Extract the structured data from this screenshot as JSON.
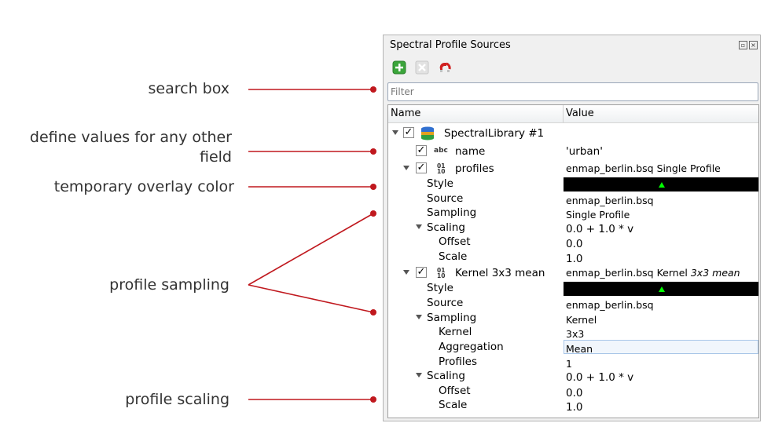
{
  "annotations": {
    "search_box": "search box",
    "define_values_line1": "define values for any other",
    "define_values_line2": "field",
    "overlay_color": "temporary overlay color",
    "profile_sampling": "profile sampling",
    "profile_scaling": "profile scaling",
    "line_color": "#c0181e"
  },
  "panel": {
    "title": "Spectral Profile Sources",
    "toolbar": {
      "add_icon": "add-icon",
      "remove_icon": "remove-icon",
      "magnet_icon": "magnet-icon"
    },
    "filter_placeholder": "Filter",
    "columns": {
      "name": "Name",
      "value": "Value"
    },
    "tree": {
      "library": {
        "label": "SpectralLibrary #1"
      },
      "name_field": {
        "label": "name",
        "value": "'urban'",
        "type_icon": "abc"
      },
      "profiles": {
        "label": "profiles",
        "value": "enmap_berlin.bsq Single Profile",
        "type_icon": "binary",
        "style_label": "Style",
        "style_color": "#000000",
        "source_label": "Source",
        "source_value": "enmap_berlin.bsq",
        "sampling_label": "Sampling",
        "sampling_value": "Single Profile",
        "scaling_label": "Scaling",
        "scaling_value": "0.0 + 1.0 * v",
        "offset_label": "Offset",
        "offset_value": "0.0",
        "scale_label": "Scale",
        "scale_value": "1.0"
      },
      "kernel": {
        "label": "Kernel 3x3 mean",
        "value_prefix": "enmap_berlin.bsq Kernel",
        "value_suffix": "3x3 mean",
        "type_icon": "binary",
        "style_label": "Style",
        "style_color": "#000000",
        "source_label": "Source",
        "source_value": "enmap_berlin.bsq",
        "sampling_label": "Sampling",
        "sampling_value": "Kernel",
        "kernel_label": "Kernel",
        "kernel_value": "3x3",
        "aggregation_label": "Aggregation",
        "aggregation_value": "Mean",
        "profiles_label": "Profiles",
        "profiles_value": "1",
        "scaling_label": "Scaling",
        "scaling_value": "0.0 + 1.0 * v",
        "offset_label": "Offset",
        "offset_value": "0.0",
        "scale_label": "Scale",
        "scale_value": "1.0"
      }
    }
  }
}
